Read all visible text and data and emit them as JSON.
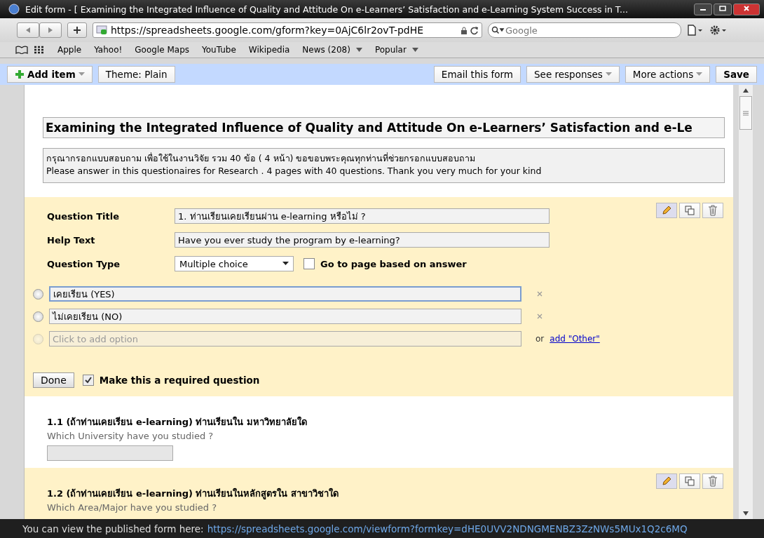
{
  "window": {
    "title": "Edit form - [ Examining the Integrated Influence of Quality and Attitude On e-Learners’ Satisfaction and e-Learning System Success in T..."
  },
  "browser": {
    "url": "https://spreadsheets.google.com/gform?key=0AjC6lr2ovT-pdHE",
    "search_placeholder": "Google",
    "bookmarks": [
      {
        "label": "Apple",
        "menu": false
      },
      {
        "label": "Yahoo!",
        "menu": false
      },
      {
        "label": "Google Maps",
        "menu": false
      },
      {
        "label": "YouTube",
        "menu": false
      },
      {
        "label": "Wikipedia",
        "menu": false
      },
      {
        "label": "News (208)",
        "menu": true
      },
      {
        "label": "Popular",
        "menu": true
      }
    ]
  },
  "toolbar": {
    "left": [
      {
        "label": "Add item",
        "menu": true,
        "plus": true
      },
      {
        "label": "Theme:  Plain",
        "menu": false,
        "plus": false
      }
    ],
    "right": [
      {
        "label": "Email this form",
        "menu": false,
        "bold": false
      },
      {
        "label": "See responses",
        "menu": true,
        "bold": false
      },
      {
        "label": "More actions",
        "menu": true,
        "bold": false
      },
      {
        "label": "Save",
        "menu": false,
        "bold": true
      }
    ]
  },
  "form": {
    "title": "Examining the Integrated Influence of Quality and Attitude On e-Learners’ Satisfaction and e-Le",
    "description": [
      "กรุณากรอกแบบสอบถาม เพื่อใช้ในงานวิจัย  รวม 40 ข้อ ( 4 หน้า) ขอขอบพระคุณทุกท่านที่ช่วยกรอกแบบสอบถาม",
      "Please answer in this questionaires for Research . 4 pages with 40 questions. Thank you very much for your kind"
    ]
  },
  "editor": {
    "title_label": "Question Title",
    "title_value": "1. ท่านเรียนเคยเรียนผ่าน e-learning หรือไม่ ?",
    "help_label": "Help Text",
    "help_value": "Have you ever study the program by e-learning?",
    "type_label": "Question Type",
    "type_value": "Multiple choice",
    "goto_label": "Go to page based on answer",
    "goto_checked": false,
    "options": [
      {
        "kind": "option",
        "value": "เคยเรียน (YES)",
        "focused": true,
        "selected": false
      },
      {
        "kind": "option",
        "value": "ไม่เคยเรียน (NO)",
        "focused": false,
        "selected": false
      },
      {
        "kind": "add",
        "placeholder": "Click to add option",
        "selected": false
      }
    ],
    "other_prefix": "or",
    "other_link": "add \"Other\"",
    "done": "Done",
    "required_label": "Make this a required question",
    "required_checked": true
  },
  "questions": [
    {
      "title": "1.1 (ถ้าท่านเคยเรียน e-learning) ท่านเรียนใน มหาวิทยาลัยใด",
      "help": "Which University have you studied ?",
      "highlighted": false,
      "answer_box": true
    },
    {
      "title": "1.2 (ถ้าท่านเคยเรียน e-learning) ท่านเรียนในหลักสูตรใน สาขาวิชาใด",
      "help": "Which Area/Major have you studied ?",
      "highlighted": true,
      "answer_box": false
    }
  ],
  "status_bar": {
    "text": "You can view the published form here:",
    "link": "https://spreadsheets.google.com/viewform?formkey=dHE0UVV2NDNGMENBZ3ZzNWs5MUx1Q2c6MQ"
  }
}
